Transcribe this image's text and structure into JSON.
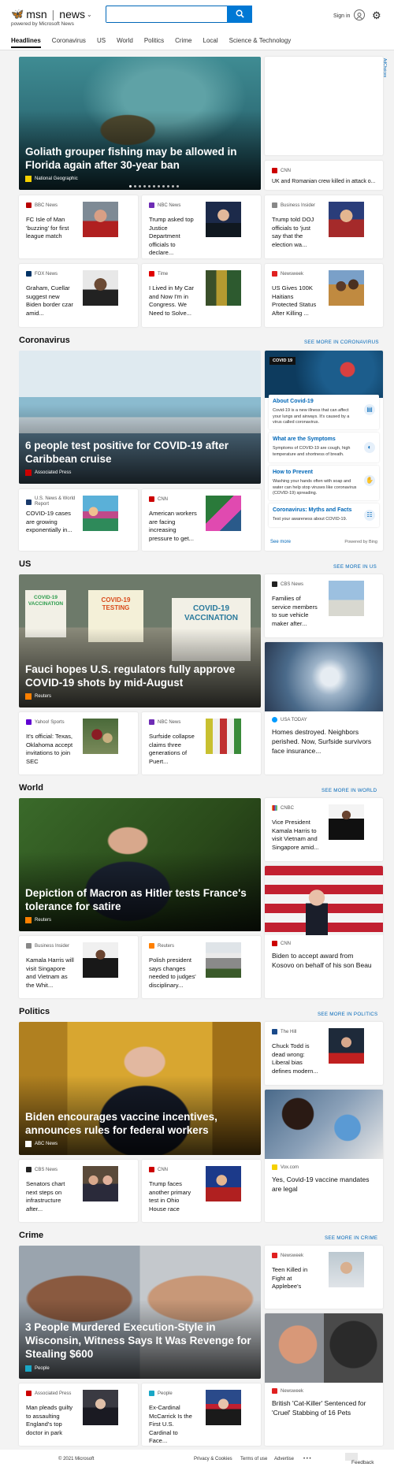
{
  "header": {
    "brand": "msn",
    "section": "news",
    "powered_by": "powered by Microsoft News",
    "search_value": "",
    "sign_in": "Sign in"
  },
  "nav": [
    "Headlines",
    "Coronavirus",
    "US",
    "World",
    "Politics",
    "Crime",
    "Local",
    "Science & Technology"
  ],
  "ad_label": "AdChoices",
  "headlines": {
    "hero": {
      "title": "Goliath grouper fishing may be allowed in Florida again after 30-year ban",
      "source": "National Geographic"
    },
    "side_top": {
      "source": "CNN",
      "title": "UK and Romanian crew killed in attack o..."
    },
    "cards": [
      {
        "source": "BBC News",
        "title": "FC Isle of Man 'buzzing' for first league match",
        "color": "#b80000"
      },
      {
        "source": "NBC News",
        "title": "Trump asked top Justice Department officials to declare...",
        "color": "#6e2cb5"
      },
      {
        "source": "Business Insider",
        "title": "Trump told DOJ officials to 'just say that the election wa...",
        "color": "#888888"
      },
      {
        "source": "FOX News",
        "title": "Graham, Cuellar suggest new Biden border czar amid...",
        "color": "#003366"
      },
      {
        "source": "Time",
        "title": "I Lived in My Car and Now I'm in Congress. We Need to Solve...",
        "color": "#e00000"
      },
      {
        "source": "Newsweek",
        "title": "US Gives 100K Haitians Protected Status After Killing ...",
        "color": "#e02020"
      }
    ]
  },
  "coronavirus": {
    "heading": "Coronavirus",
    "see_more": "SEE MORE IN CORONAVIRUS",
    "hero": {
      "title": "6 people test positive for COVID-19 after Caribbean cruise",
      "source": "Associated Press"
    },
    "cards": [
      {
        "source": "U.S. News & World Report",
        "title": "COVID-19 cases are growing exponentially in...",
        "color": "#1a3a6b"
      },
      {
        "source": "CNN",
        "title": "American workers are facing increasing pressure to get...",
        "color": "#cc0000"
      }
    ],
    "panel": {
      "label": "COVID 19",
      "items": [
        {
          "title": "About Covid-19",
          "text": "Covid-19 is a new illness that can affect your lungs and airways. It's caused by a virus called coronavirus."
        },
        {
          "title": "What are the Symptoms",
          "text": "Symptoms of COVID-19 are cough, high temperature and shortness of breath."
        },
        {
          "title": "How to Prevent",
          "text": "Washing your hands often with soap and water can help stop viruses like coronavirus (COVID-19) spreading."
        },
        {
          "title": "Coronavirus: Myths and Facts",
          "text": "Test your awareness about COVID-19."
        }
      ],
      "see_more": "See more",
      "powered": "Powered by Bing"
    }
  },
  "us": {
    "heading": "US",
    "see_more": "SEE MORE IN US",
    "hero": {
      "title": "Fauci hopes U.S. regulators fully approve COVID-19 shots by mid-August",
      "source": "Reuters",
      "signs": [
        "COVID-19 VACCINATION",
        "COVID-19 TESTING",
        "COVID-19 VACCINATION"
      ]
    },
    "side_top": {
      "source": "CBS News",
      "title": "Families of service members to sue vehicle maker after..."
    },
    "side_bottom": {
      "source": "USA TODAY",
      "title": "Homes destroyed. Neighbors perished. Now, Surfside survivors face insurance..."
    },
    "cards": [
      {
        "source": "Yahoo! Sports",
        "title": "It's official: Texas, Oklahoma accept invitations to join SEC",
        "color": "#6001d2"
      },
      {
        "source": "NBC News",
        "title": "Surfside collapse claims three generations of Puert...",
        "color": "#6e2cb5"
      }
    ]
  },
  "world": {
    "heading": "World",
    "see_more": "SEE MORE IN WORLD",
    "hero": {
      "title": "Depiction of Macron as Hitler tests France's tolerance for satire",
      "source": "Reuters"
    },
    "side_top": {
      "source": "CNBC",
      "title": "Vice President Kamala Harris to visit Vietnam and Singapore amid..."
    },
    "side_bottom": {
      "source": "CNN",
      "title": "Biden to accept award from Kosovo on behalf of his son Beau"
    },
    "cards": [
      {
        "source": "Business Insider",
        "title": "Kamala Harris will visit Singapore and Vietnam as the Whit...",
        "color": "#888888"
      },
      {
        "source": "Reuters",
        "title": "Polish president says changes needed to judges' disciplinary...",
        "color": "#ff8000"
      }
    ]
  },
  "politics": {
    "heading": "Politics",
    "see_more": "SEE MORE IN POLITICS",
    "hero": {
      "title": "Biden encourages vaccine incentives, announces rules for federal workers",
      "source": "ABC News"
    },
    "side_top": {
      "source": "The Hill",
      "title": "Chuck Todd is dead wrong: Liberal bias defines modern..."
    },
    "side_bottom": {
      "source": "Vox.com",
      "title": "Yes, Covid-19 vaccine mandates are legal"
    },
    "cards": [
      {
        "source": "CBS News",
        "title": "Senators chart next steps on infrastructure after...",
        "color": "#222222"
      },
      {
        "source": "CNN",
        "title": "Trump faces another primary test in Ohio House race",
        "color": "#cc0000"
      }
    ]
  },
  "crime": {
    "heading": "Crime",
    "see_more": "SEE MORE IN CRIME",
    "hero": {
      "title": "3 People Murdered Execution-Style in Wisconsin, Witness Says It Was Revenge for Stealing $600",
      "source": "People"
    },
    "side_top": {
      "source": "Newsweek",
      "title": "Teen Killed in Fight at Applebee's"
    },
    "side_bottom": {
      "source": "Newsweek",
      "title": "British 'Cat-Killer' Sentenced for 'Cruel' Stabbing of 16 Pets"
    },
    "cards": [
      {
        "source": "Associated Press",
        "title": "Man pleads guilty to assaulting England's top doctor in park",
        "color": "#cc0000"
      },
      {
        "source": "People",
        "title": "Ex-Cardinal McCarrick Is the First U.S. Cardinal to Face...",
        "color": "#19a7c6"
      }
    ]
  },
  "footer": {
    "copyright": "© 2021 Microsoft",
    "privacy": "Privacy & Cookies",
    "terms": "Terms of use",
    "advertise": "Advertise",
    "ellipsis": "• • •",
    "feedback": "Feedback"
  }
}
